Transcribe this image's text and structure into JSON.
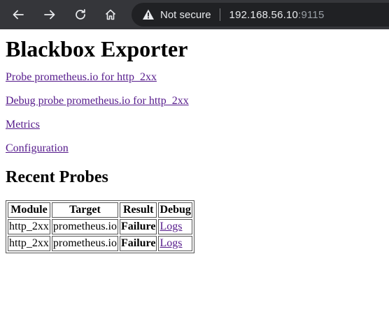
{
  "browser": {
    "security_label": "Not secure",
    "url_host": "192.168.56.10",
    "url_port": ":9115",
    "icons": [
      "back-arrow-icon",
      "forward-arrow-icon",
      "reload-icon",
      "home-icon",
      "warning-triangle-icon"
    ]
  },
  "page": {
    "title": "Blackbox Exporter",
    "links": {
      "probe": "Probe prometheus.io for http_2xx",
      "debug": "Debug probe prometheus.io for http_2xx",
      "metrics": "Metrics",
      "configuration": "Configuration"
    },
    "recent_title": "Recent Probes",
    "table": {
      "headers": [
        "Module",
        "Target",
        "Result",
        "Debug"
      ],
      "rows": [
        {
          "module": "http_2xx",
          "target": "prometheus.io",
          "result": "Failure",
          "debug": "Logs"
        },
        {
          "module": "http_2xx",
          "target": "prometheus.io",
          "result": "Failure",
          "debug": "Logs"
        }
      ]
    }
  },
  "colors": {
    "toolbar": "#35363a",
    "omnibox": "#202124",
    "link_visited": "#551a8b"
  }
}
